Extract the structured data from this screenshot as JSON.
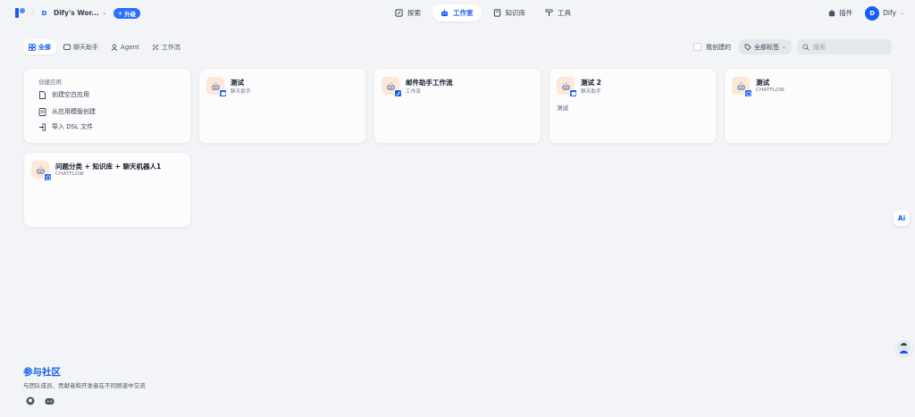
{
  "header": {
    "workspace_initial": "D",
    "workspace_name": "Dify's Wor...",
    "upgrade_label": "升级",
    "nav": [
      {
        "label": "探索",
        "icon": "explore-icon"
      },
      {
        "label": "工作室",
        "icon": "robot-icon"
      },
      {
        "label": "知识库",
        "icon": "book-icon"
      },
      {
        "label": "工具",
        "icon": "hammer-icon"
      }
    ],
    "plugins_label": "插件",
    "user_initial": "D",
    "user_name": "Dify"
  },
  "filters": {
    "tabs": [
      {
        "label": "全部",
        "icon": "grid-icon"
      },
      {
        "label": "聊天助手",
        "icon": "chat-icon"
      },
      {
        "label": "Agent",
        "icon": "agent-icon"
      },
      {
        "label": "工作流",
        "icon": "workflow-icon"
      }
    ],
    "my_created_label": "我创建的",
    "tags_label": "全部标签",
    "search_placeholder": "搜索"
  },
  "create": {
    "title": "创建应用",
    "items": [
      {
        "label": "创建空白应用",
        "icon": "file-plus-icon"
      },
      {
        "label": "从应用模版创建",
        "icon": "template-icon"
      },
      {
        "label": "导入 DSL 文件",
        "icon": "import-icon"
      }
    ]
  },
  "apps": [
    {
      "name": "测试",
      "type": "聊天助手",
      "description": ""
    },
    {
      "name": "邮件助手工作流",
      "type": "工作流",
      "description": ""
    },
    {
      "name": "测试 2",
      "type": "聊天助手",
      "description": "测试"
    },
    {
      "name": "测试",
      "type": "CHATFLOW",
      "description": ""
    },
    {
      "name": "问题分类 + 知识库 + 聊天机器人1",
      "type": "CHATFLOW",
      "description": ""
    }
  ],
  "footer": {
    "title": "参与社区",
    "description": "与团队成员、贡献者和开发者在不同频道中交流"
  },
  "ai_button_label": "Ai",
  "colors": {
    "accent": "#155eef",
    "background": "#f2f4f7",
    "card": "#fcfcfd",
    "icon_bg": "#fde8d8"
  }
}
